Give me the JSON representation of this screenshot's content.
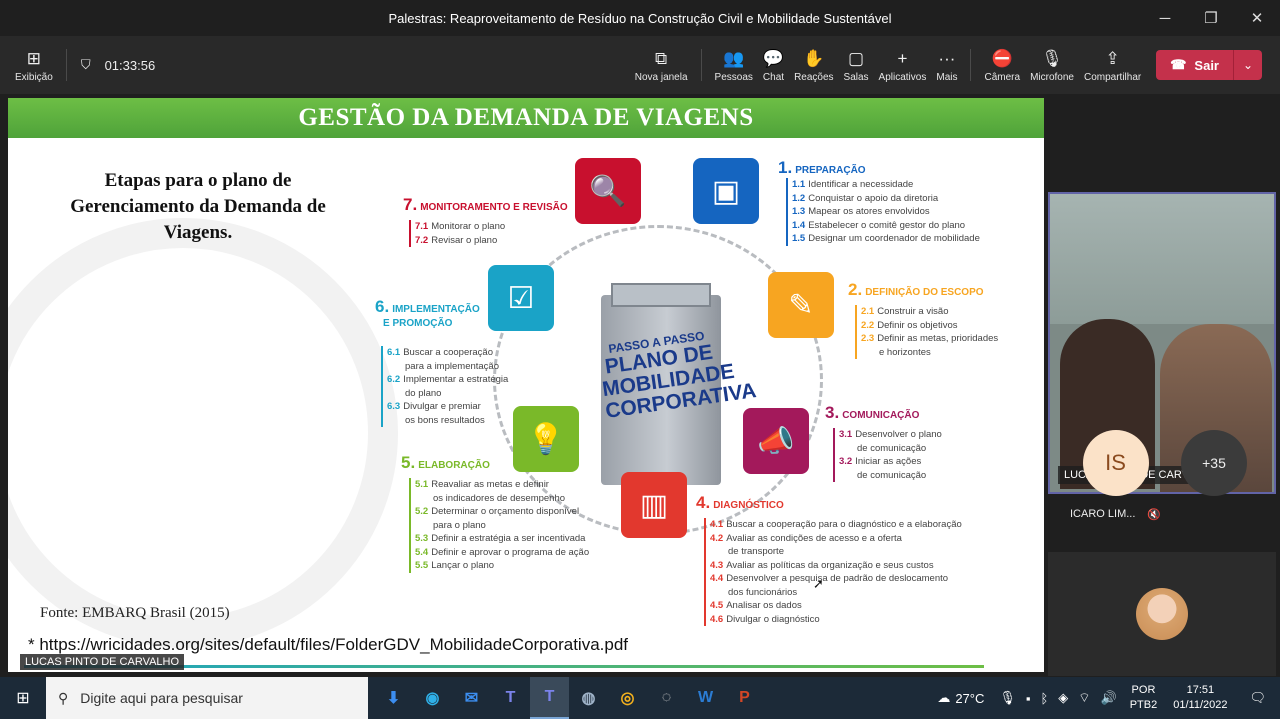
{
  "window": {
    "title": "Palestras: Reaproveitamento de Resíduo na Construção Civil e Mobilidade Sustentável",
    "minimize": "─",
    "maximize": "❐",
    "close": "✕"
  },
  "toolbar": {
    "view_label": "Exibição",
    "timer": "01:33:56",
    "buttons": [
      {
        "label": "Nova janela",
        "icon": "⧉"
      },
      {
        "label": "Pessoas",
        "icon": "👥"
      },
      {
        "label": "Chat",
        "icon": "💬"
      },
      {
        "label": "Reações",
        "icon": "✋"
      },
      {
        "label": "Salas",
        "icon": "▢"
      },
      {
        "label": "Aplicativos",
        "icon": "+"
      },
      {
        "label": "Mais",
        "icon": "···"
      }
    ],
    "camera_label": "Câmera",
    "mic_label": "Microfone",
    "share_label": "Compartilhar",
    "leave_label": "Sair"
  },
  "slide": {
    "title": "GESTÃO DA DEMANDA DE VIAGENS",
    "subtitle_line1": "Etapas para o plano de",
    "subtitle_line2": "Gerenciamento da Demanda de",
    "subtitle_line3": "Viagens.",
    "source": "Fonte: EMBARQ Brasil (2015)",
    "url": "* https://wricidades.org/sites/default/files/FolderGDV_MobilidadeCorporativa.pdf",
    "building_top": "PASSO A PASSO",
    "building_main": "PLANO DE MOBILIDADE CORPORATIVA",
    "steps": [
      {
        "num": "1.",
        "title": "PREPARAÇÃO",
        "items": [
          [
            "1.1",
            "Identificar a necessidade"
          ],
          [
            "1.2",
            "Conquistar o apoio da diretoria"
          ],
          [
            "1.3",
            "Mapear os atores envolvidos"
          ],
          [
            "1.4",
            "Estabelecer o comitê gestor do plano"
          ],
          [
            "1.5",
            "Designar um coordenador de mobilidade"
          ]
        ]
      },
      {
        "num": "2.",
        "title": "DEFINIÇÃO DO ESCOPO",
        "items": [
          [
            "2.1",
            "Construir a visão"
          ],
          [
            "2.2",
            "Definir os objetivos"
          ],
          [
            "2.3",
            "Definir as metas, prioridades"
          ],
          [
            "",
            "e horizontes"
          ]
        ]
      },
      {
        "num": "3.",
        "title": "COMUNICAÇÃO",
        "items": [
          [
            "3.1",
            "Desenvolver o plano"
          ],
          [
            "",
            "de comunicação"
          ],
          [
            "3.2",
            "Iniciar as ações"
          ],
          [
            "",
            "de comunicação"
          ]
        ]
      },
      {
        "num": "4.",
        "title": "DIAGNÓSTICO",
        "items": [
          [
            "4.1",
            "Buscar a cooperação para o diagnóstico e a elaboração"
          ],
          [
            "4.2",
            "Avaliar as condições de acesso e a oferta"
          ],
          [
            "",
            "de transporte"
          ],
          [
            "4.3",
            "Avaliar as políticas da organização e seus custos"
          ],
          [
            "4.4",
            "Desenvolver a pesquisa de padrão de deslocamento"
          ],
          [
            "",
            "dos funcionários"
          ],
          [
            "4.5",
            "Analisar os dados"
          ],
          [
            "4.6",
            "Divulgar o diagnóstico"
          ]
        ]
      },
      {
        "num": "5.",
        "title": "ELABORAÇÃO",
        "items": [
          [
            "5.1",
            "Reavaliar as metas e definir"
          ],
          [
            "",
            "os indicadores de desempenho"
          ],
          [
            "5.2",
            "Determinar o orçamento disponível"
          ],
          [
            "",
            "para o plano"
          ],
          [
            "5.3",
            "Definir a estratégia a ser incentivada"
          ],
          [
            "5.4",
            "Definir e aprovar o programa de ação"
          ],
          [
            "5.5",
            "Lançar o plano"
          ]
        ]
      },
      {
        "num": "6.",
        "title": "IMPLEMENTAÇÃO",
        "title2": "E PROMOÇÃO",
        "items": [
          [
            "6.1",
            "Buscar a cooperação"
          ],
          [
            "",
            "para a implementação"
          ],
          [
            "6.2",
            "Implementar a estratégia"
          ],
          [
            "",
            "do plano"
          ],
          [
            "6.3",
            "Divulgar e premiar"
          ],
          [
            "",
            "os bons resultados"
          ]
        ]
      },
      {
        "num": "7.",
        "title": "MONITORAMENTO E REVISÃO",
        "items": [
          [
            "7.1",
            "Monitorar o plano"
          ],
          [
            "7.2",
            "Revisar o plano"
          ]
        ]
      }
    ],
    "colors": {
      "green": "#6dbe45",
      "blue": "#1565c0",
      "orange": "#f7a521",
      "magenta": "#a3195b",
      "red": "#e2382e",
      "lime": "#7ab929",
      "cyan": "#1aa3c7",
      "crimson": "#c8102e"
    },
    "presenter_tag": "LUCAS PINTO DE CARVALHO"
  },
  "participants": {
    "video_name": "LUCAS PINTO DE CARVALHO",
    "is_initials": "IS",
    "is_name": "ICARO LIM...",
    "more": "+35"
  },
  "taskbar": {
    "search_placeholder": "Digite aqui para pesquisar",
    "weather": "27°C",
    "lang1": "POR",
    "lang2": "PTB2",
    "time": "17:51",
    "date": "01/11/2022"
  }
}
